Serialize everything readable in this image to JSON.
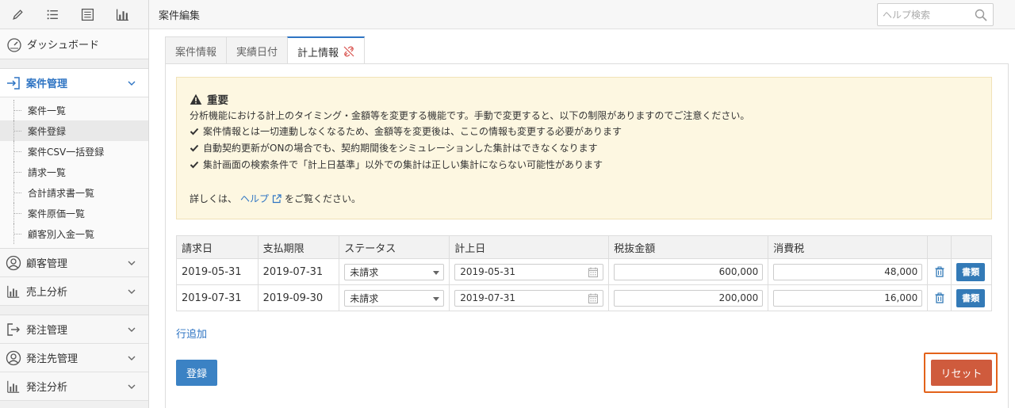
{
  "sidebar": {
    "toolbar": [
      "pencil-icon",
      "list-icon",
      "list-box-icon",
      "bar-chart-icon"
    ],
    "dashboard": "ダッシュボード",
    "case_mgmt": "案件管理",
    "case_items": [
      "案件一覧",
      "案件登録",
      "案件CSV一括登録",
      "請求一覧",
      "合計請求書一覧",
      "案件原価一覧",
      "顧客別入金一覧"
    ],
    "customer_mgmt": "顧客管理",
    "sales_analysis": "売上分析",
    "order_mgmt": "発注管理",
    "supplier_mgmt": "発注先管理",
    "order_analysis": "発注分析"
  },
  "header": {
    "title": "案件編集",
    "search_placeholder": "ヘルプ検索"
  },
  "tabs": [
    "案件情報",
    "実績日付",
    "計上情報"
  ],
  "notice": {
    "title": "重要",
    "desc": "分析機能における計上のタイミング・金額等を変更する機能です。手動で変更すると、以下の制限がありますのでご注意ください。",
    "items": [
      "案件情報とは一切連動しなくなるため、金額等を変更後は、ここの情報も変更する必要があります",
      "自動契約更新がONの場合でも、契約期間後をシミュレーションした集計はできなくなります",
      "集計画面の検索条件で「計上日基準」以外での集計は正しい集計にならない可能性があります"
    ],
    "help_prefix": "詳しくは、",
    "help_link": "ヘルプ",
    "help_suffix": "をご覧ください。"
  },
  "table": {
    "headers": [
      "請求日",
      "支払期限",
      "ステータス",
      "計上日",
      "税抜金額",
      "消費税"
    ],
    "rows": [
      {
        "billing_date": "2019-05-31",
        "due_date": "2019-07-31",
        "status": "未請求",
        "record_date": "2019-05-31",
        "amount": "600,000",
        "tax": "48,000",
        "doc_label": "書類"
      },
      {
        "billing_date": "2019-07-31",
        "due_date": "2019-09-30",
        "status": "未請求",
        "record_date": "2019-07-31",
        "amount": "200,000",
        "tax": "16,000",
        "doc_label": "書類"
      }
    ]
  },
  "actions": {
    "add_row": "行追加",
    "submit": "登録",
    "reset": "リセット"
  },
  "colors": {
    "accent": "#2e74c3",
    "reset": "#cf5b3d",
    "highlight": "#e3621a",
    "notice_bg": "#fdf7e1"
  }
}
